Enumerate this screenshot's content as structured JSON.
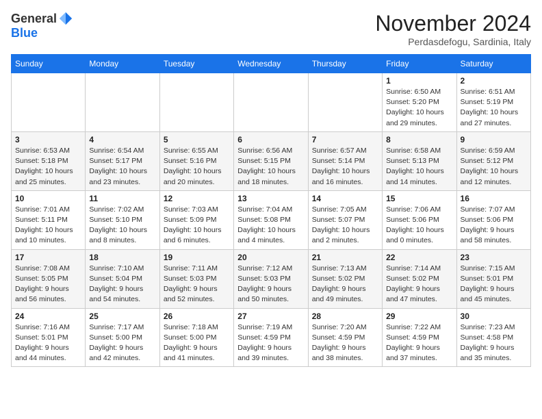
{
  "header": {
    "logo_general": "General",
    "logo_blue": "Blue",
    "month_title": "November 2024",
    "subtitle": "Perdasdefogu, Sardinia, Italy"
  },
  "calendar": {
    "days_of_week": [
      "Sunday",
      "Monday",
      "Tuesday",
      "Wednesday",
      "Thursday",
      "Friday",
      "Saturday"
    ],
    "weeks": [
      [
        {
          "day": "",
          "info": ""
        },
        {
          "day": "",
          "info": ""
        },
        {
          "day": "",
          "info": ""
        },
        {
          "day": "",
          "info": ""
        },
        {
          "day": "",
          "info": ""
        },
        {
          "day": "1",
          "info": "Sunrise: 6:50 AM\nSunset: 5:20 PM\nDaylight: 10 hours and 29 minutes."
        },
        {
          "day": "2",
          "info": "Sunrise: 6:51 AM\nSunset: 5:19 PM\nDaylight: 10 hours and 27 minutes."
        }
      ],
      [
        {
          "day": "3",
          "info": "Sunrise: 6:53 AM\nSunset: 5:18 PM\nDaylight: 10 hours and 25 minutes."
        },
        {
          "day": "4",
          "info": "Sunrise: 6:54 AM\nSunset: 5:17 PM\nDaylight: 10 hours and 23 minutes."
        },
        {
          "day": "5",
          "info": "Sunrise: 6:55 AM\nSunset: 5:16 PM\nDaylight: 10 hours and 20 minutes."
        },
        {
          "day": "6",
          "info": "Sunrise: 6:56 AM\nSunset: 5:15 PM\nDaylight: 10 hours and 18 minutes."
        },
        {
          "day": "7",
          "info": "Sunrise: 6:57 AM\nSunset: 5:14 PM\nDaylight: 10 hours and 16 minutes."
        },
        {
          "day": "8",
          "info": "Sunrise: 6:58 AM\nSunset: 5:13 PM\nDaylight: 10 hours and 14 minutes."
        },
        {
          "day": "9",
          "info": "Sunrise: 6:59 AM\nSunset: 5:12 PM\nDaylight: 10 hours and 12 minutes."
        }
      ],
      [
        {
          "day": "10",
          "info": "Sunrise: 7:01 AM\nSunset: 5:11 PM\nDaylight: 10 hours and 10 minutes."
        },
        {
          "day": "11",
          "info": "Sunrise: 7:02 AM\nSunset: 5:10 PM\nDaylight: 10 hours and 8 minutes."
        },
        {
          "day": "12",
          "info": "Sunrise: 7:03 AM\nSunset: 5:09 PM\nDaylight: 10 hours and 6 minutes."
        },
        {
          "day": "13",
          "info": "Sunrise: 7:04 AM\nSunset: 5:08 PM\nDaylight: 10 hours and 4 minutes."
        },
        {
          "day": "14",
          "info": "Sunrise: 7:05 AM\nSunset: 5:07 PM\nDaylight: 10 hours and 2 minutes."
        },
        {
          "day": "15",
          "info": "Sunrise: 7:06 AM\nSunset: 5:06 PM\nDaylight: 10 hours and 0 minutes."
        },
        {
          "day": "16",
          "info": "Sunrise: 7:07 AM\nSunset: 5:06 PM\nDaylight: 9 hours and 58 minutes."
        }
      ],
      [
        {
          "day": "17",
          "info": "Sunrise: 7:08 AM\nSunset: 5:05 PM\nDaylight: 9 hours and 56 minutes."
        },
        {
          "day": "18",
          "info": "Sunrise: 7:10 AM\nSunset: 5:04 PM\nDaylight: 9 hours and 54 minutes."
        },
        {
          "day": "19",
          "info": "Sunrise: 7:11 AM\nSunset: 5:03 PM\nDaylight: 9 hours and 52 minutes."
        },
        {
          "day": "20",
          "info": "Sunrise: 7:12 AM\nSunset: 5:03 PM\nDaylight: 9 hours and 50 minutes."
        },
        {
          "day": "21",
          "info": "Sunrise: 7:13 AM\nSunset: 5:02 PM\nDaylight: 9 hours and 49 minutes."
        },
        {
          "day": "22",
          "info": "Sunrise: 7:14 AM\nSunset: 5:02 PM\nDaylight: 9 hours and 47 minutes."
        },
        {
          "day": "23",
          "info": "Sunrise: 7:15 AM\nSunset: 5:01 PM\nDaylight: 9 hours and 45 minutes."
        }
      ],
      [
        {
          "day": "24",
          "info": "Sunrise: 7:16 AM\nSunset: 5:01 PM\nDaylight: 9 hours and 44 minutes."
        },
        {
          "day": "25",
          "info": "Sunrise: 7:17 AM\nSunset: 5:00 PM\nDaylight: 9 hours and 42 minutes."
        },
        {
          "day": "26",
          "info": "Sunrise: 7:18 AM\nSunset: 5:00 PM\nDaylight: 9 hours and 41 minutes."
        },
        {
          "day": "27",
          "info": "Sunrise: 7:19 AM\nSunset: 4:59 PM\nDaylight: 9 hours and 39 minutes."
        },
        {
          "day": "28",
          "info": "Sunrise: 7:20 AM\nSunset: 4:59 PM\nDaylight: 9 hours and 38 minutes."
        },
        {
          "day": "29",
          "info": "Sunrise: 7:22 AM\nSunset: 4:59 PM\nDaylight: 9 hours and 37 minutes."
        },
        {
          "day": "30",
          "info": "Sunrise: 7:23 AM\nSunset: 4:58 PM\nDaylight: 9 hours and 35 minutes."
        }
      ]
    ]
  }
}
